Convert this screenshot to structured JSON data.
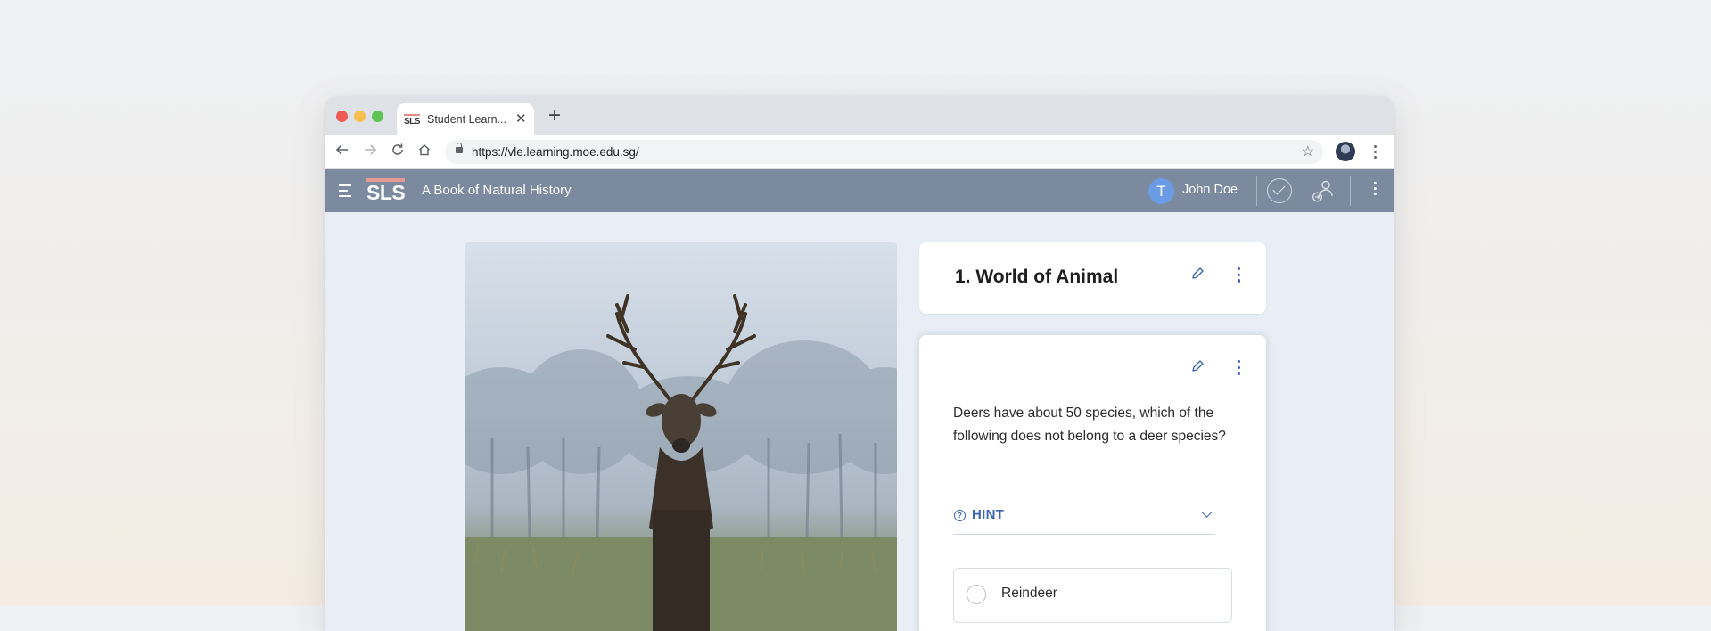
{
  "browser": {
    "tab_title": "Student Learn...",
    "favicon_text": "SLS",
    "url": "https://vle.learning.moe.edu.sg/",
    "icons": {
      "back": "arrow-left-icon",
      "forward": "arrow-right-icon",
      "reload": "reload-icon",
      "home": "home-icon",
      "lock": "lock-icon",
      "bookmark": "star-icon",
      "menu": "vertical-dots-icon"
    }
  },
  "app": {
    "logo": "SLS",
    "title": "A Book of Natural History",
    "user": {
      "initial": "T",
      "name": "John Doe"
    },
    "colors": {
      "header": "#7b8a9e",
      "accent": "#3b64b4",
      "avatar": "#6c9be6"
    }
  },
  "section": {
    "title": "1. World of Animal"
  },
  "question_card": {
    "question": "Deers have about 50 species, which of the following does not belong to a deer species?",
    "hint_label": "HINT",
    "options": [
      "Reindeer"
    ]
  }
}
